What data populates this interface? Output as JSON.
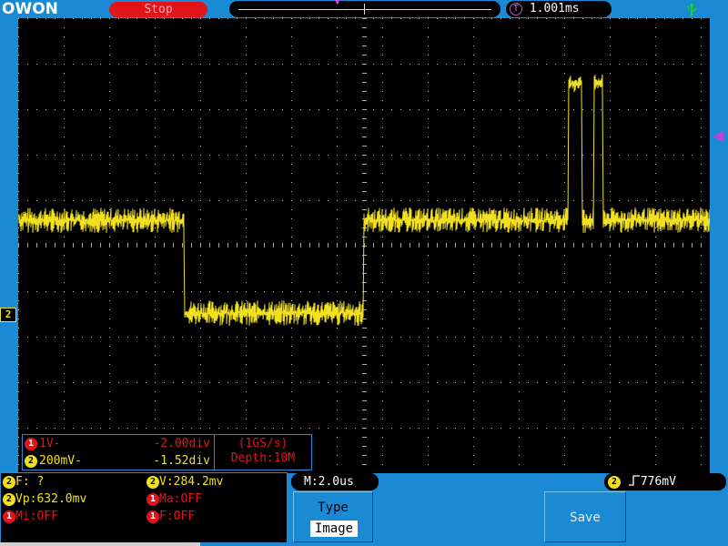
{
  "header": {
    "brand": "OWON",
    "run_state": "Stop",
    "trigger_time": "1.001ms"
  },
  "channels": [
    {
      "id": "1",
      "volts_div": "1V-",
      "offset": "-2.00div"
    },
    {
      "id": "2",
      "volts_div": "200mV-",
      "offset": "-1.52div"
    }
  ],
  "acquisition": {
    "sample_rate": "(1GS/s)",
    "depth": "Depth:10M"
  },
  "measurements": {
    "freq": "F:  ?",
    "vpp": "Vp:632.0mv",
    "vamp": "V:284.2mv",
    "max": "Ma:OFF",
    "min": "Mi:OFF",
    "freq_ch1": "F:OFF"
  },
  "timebase": "M:2.0us",
  "trigger": {
    "channel": "2",
    "level": "776mV"
  },
  "menu": {
    "type_label": "Type",
    "type_value": "Image",
    "save_label": "Save"
  },
  "markers": {
    "ch2": "2"
  },
  "colors": {
    "ch1": "#e0141a",
    "ch2": "#f0e020",
    "background": "#1a8ad4",
    "trigger": "#c040e0"
  }
}
